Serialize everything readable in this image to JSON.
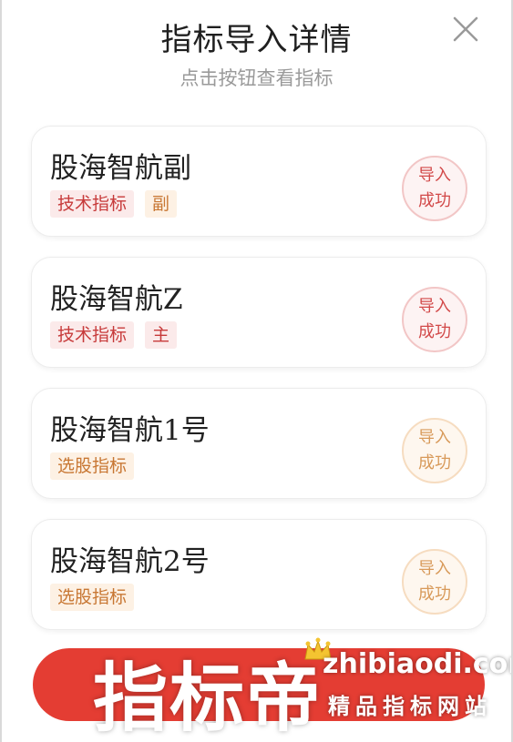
{
  "dialog": {
    "title": "指标导入详情",
    "subtitle": "点击按钮查看指标",
    "close_icon": "close-icon"
  },
  "items": [
    {
      "name": "股海智航副",
      "tags": [
        "技术指标",
        "副"
      ],
      "status_line1": "导入",
      "status_line2": "成功"
    },
    {
      "name": "股海智航Z",
      "tags": [
        "技术指标",
        "主"
      ],
      "status_line1": "导入",
      "status_line2": "成功"
    },
    {
      "name": "股海智航1号",
      "tags": [
        "选股指标"
      ],
      "status_line1": "导入",
      "status_line2": "成功"
    },
    {
      "name": "股海智航2号",
      "tags": [
        "选股指标"
      ],
      "status_line1": "导入",
      "status_line2": "成功"
    }
  ],
  "watermark": {
    "main": "指标帝",
    "domain": "zhibiaodi.com",
    "tagline": "精品指标网站"
  },
  "colors": {
    "accent_red": "#e43d33",
    "tag_red": "#c73a3a",
    "tag_orange": "#c87733"
  }
}
